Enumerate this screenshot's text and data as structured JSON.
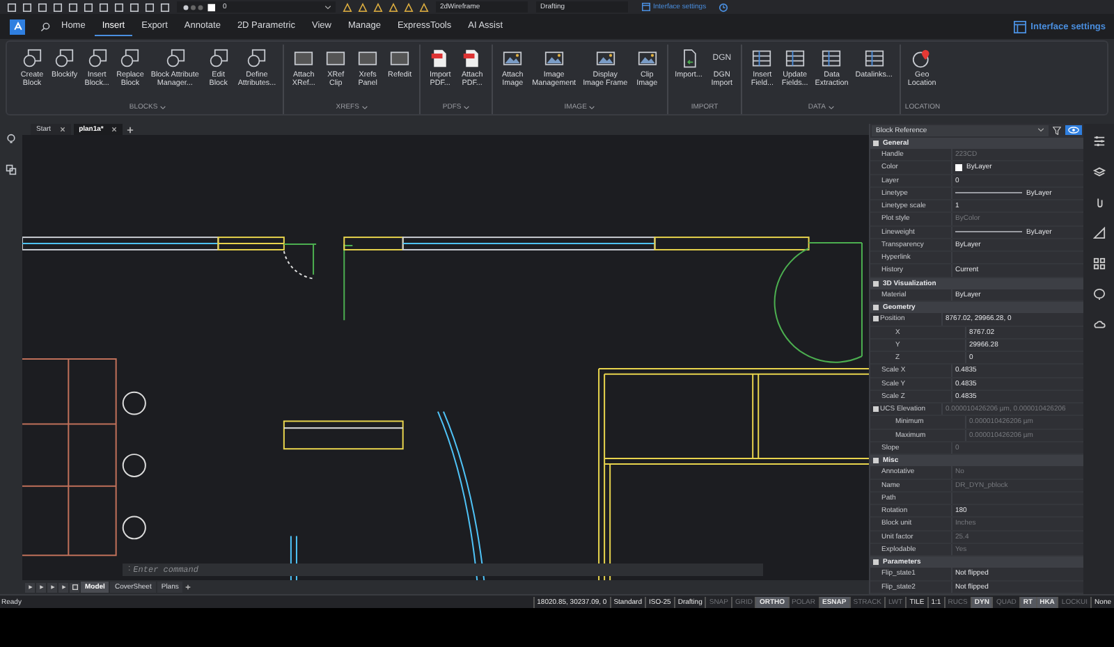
{
  "top_bar": {
    "layer_value": "0",
    "visual_style": "2dWireframe",
    "workspace": "Drafting",
    "settings_link": "Interface settings"
  },
  "ribbon_tabs": [
    {
      "label": "Home",
      "selected": false
    },
    {
      "label": "Insert",
      "selected": true
    },
    {
      "label": "Export",
      "selected": false
    },
    {
      "label": "Annotate",
      "selected": false
    },
    {
      "label": "2D Parametric",
      "selected": false
    },
    {
      "label": "View",
      "selected": false
    },
    {
      "label": "Manage",
      "selected": false
    },
    {
      "label": "ExpressTools",
      "selected": false
    },
    {
      "label": "AI Assist",
      "selected": false
    }
  ],
  "interface_settings": "Interface settings",
  "ribbon_panels": [
    {
      "title": "BLOCKS",
      "kind": "blocks",
      "expandable": true,
      "buttons": [
        {
          "lines": [
            "Create",
            "Block"
          ]
        },
        {
          "lines": [
            "Blockify"
          ]
        },
        {
          "lines": [
            "Insert",
            "Block..."
          ]
        },
        {
          "lines": [
            "Replace",
            "Block"
          ]
        },
        {
          "lines": [
            "Block Attribute",
            "Manager..."
          ]
        },
        {
          "lines": [
            "Edit",
            "Block"
          ]
        },
        {
          "lines": [
            "Define",
            "Attributes..."
          ]
        }
      ]
    },
    {
      "title": "XREFS",
      "kind": "xrefs",
      "expandable": true,
      "buttons": [
        {
          "lines": [
            "Attach",
            "XRef..."
          ]
        },
        {
          "lines": [
            "XRef",
            "Clip"
          ]
        },
        {
          "lines": [
            "Xrefs",
            "Panel"
          ]
        },
        {
          "lines": [
            "Refedit"
          ]
        }
      ]
    },
    {
      "title": "PDFS",
      "kind": "pdfs",
      "expandable": true,
      "buttons": [
        {
          "lines": [
            "Import",
            "PDF..."
          ]
        },
        {
          "lines": [
            "Attach",
            "PDF..."
          ]
        }
      ]
    },
    {
      "title": "IMAGE",
      "kind": "image",
      "expandable": true,
      "buttons": [
        {
          "lines": [
            "Attach",
            "Image"
          ]
        },
        {
          "lines": [
            "Image",
            "Management"
          ]
        },
        {
          "lines": [
            "Display",
            "Image Frame"
          ]
        },
        {
          "lines": [
            "Clip",
            "Image"
          ]
        }
      ]
    },
    {
      "title": "IMPORT",
      "kind": "import",
      "expandable": false,
      "buttons": [
        {
          "lines": [
            "Import..."
          ]
        },
        {
          "lines": [
            "DGN",
            "Import"
          ],
          "icon_text": "DGN"
        }
      ]
    },
    {
      "title": "DATA",
      "kind": "data",
      "expandable": true,
      "buttons": [
        {
          "lines": [
            "Insert",
            "Field..."
          ]
        },
        {
          "lines": [
            "Update",
            "Fields..."
          ]
        },
        {
          "lines": [
            "Data",
            "Extraction"
          ]
        },
        {
          "lines": [
            "Datalinks..."
          ]
        }
      ]
    },
    {
      "title": "LOCATION",
      "kind": "location",
      "expandable": false,
      "buttons": [
        {
          "lines": [
            "Geo",
            "Location"
          ]
        }
      ]
    }
  ],
  "document_tabs": [
    {
      "label": "Start",
      "selected": false
    },
    {
      "label": "plan1a*",
      "selected": true
    }
  ],
  "command_line": {
    "prompt": ":",
    "placeholder": "Enter command"
  },
  "layout_tabs": [
    {
      "label": "Model",
      "selected": true
    },
    {
      "label": "CoverSheet",
      "selected": false
    },
    {
      "label": "Plans",
      "selected": false
    }
  ],
  "properties": {
    "object_type": "Block Reference",
    "rows": [
      {
        "kind": "section",
        "label": "General"
      },
      {
        "kind": "text",
        "label": "Handle",
        "value": "223CD",
        "dimmed": true
      },
      {
        "kind": "color",
        "label": "Color",
        "value": "ByLayer",
        "dimmed": false
      },
      {
        "kind": "text",
        "label": "Layer",
        "value": "0",
        "dimmed": false
      },
      {
        "kind": "line",
        "label": "Linetype",
        "value": "ByLayer",
        "dimmed": false
      },
      {
        "kind": "text",
        "label": "Linetype scale",
        "value": "1",
        "dimmed": false
      },
      {
        "kind": "text",
        "label": "Plot style",
        "value": "ByColor",
        "dimmed": true
      },
      {
        "kind": "line",
        "label": "Lineweight",
        "value": "ByLayer",
        "dimmed": false
      },
      {
        "kind": "text",
        "label": "Transparency",
        "value": "ByLayer",
        "dimmed": false
      },
      {
        "kind": "text",
        "label": "Hyperlink",
        "value": ""
      },
      {
        "kind": "text",
        "label": "History",
        "value": "Current",
        "dimmed": false
      },
      {
        "kind": "section",
        "label": "3D Visualization"
      },
      {
        "kind": "text",
        "label": "Material",
        "value": "ByLayer",
        "dimmed": false
      },
      {
        "kind": "section",
        "label": "Geometry"
      },
      {
        "kind": "text",
        "label": "Position",
        "value": "8767.02, 29966.28, 0",
        "dimmed": false,
        "children": [
          {
            "kind": "text",
            "label": "X",
            "value": "8767.02",
            "dimmed": false
          },
          {
            "kind": "text",
            "label": "Y",
            "value": "29966.28",
            "dimmed": false
          },
          {
            "kind": "text",
            "label": "Z",
            "value": "0",
            "dimmed": false
          }
        ]
      },
      {
        "kind": "text",
        "label": "Scale X",
        "value": "0.4835",
        "dimmed": false
      },
      {
        "kind": "text",
        "label": "Scale Y",
        "value": "0.4835",
        "dimmed": false
      },
      {
        "kind": "text",
        "label": "Scale Z",
        "value": "0.4835",
        "dimmed": false
      },
      {
        "kind": "text",
        "label": "UCS Elevation",
        "value": "0.000010426206 µm, 0.000010426206",
        "dimmed": true,
        "children": [
          {
            "kind": "text",
            "label": "Minimum",
            "value": "0.000010426206 µm",
            "dimmed": true
          },
          {
            "kind": "text",
            "label": "Maximum",
            "value": "0.000010426206 µm",
            "dimmed": true
          }
        ]
      },
      {
        "kind": "text",
        "label": "Slope",
        "value": "0",
        "dimmed": true
      },
      {
        "kind": "section",
        "label": "Misc"
      },
      {
        "kind": "text",
        "label": "Annotative",
        "value": "No",
        "dimmed": true
      },
      {
        "kind": "text",
        "label": "Name",
        "value": "DR_DYN_pblock",
        "dimmed": true
      },
      {
        "kind": "text",
        "label": "Path",
        "value": ""
      },
      {
        "kind": "text",
        "label": "Rotation",
        "value": "180",
        "dimmed": false
      },
      {
        "kind": "text",
        "label": "Block unit",
        "value": "Inches",
        "dimmed": true
      },
      {
        "kind": "text",
        "label": "Unit factor",
        "value": "25.4",
        "dimmed": true
      },
      {
        "kind": "text",
        "label": "Explodable",
        "value": "Yes",
        "dimmed": true
      },
      {
        "kind": "section",
        "label": "Parameters"
      },
      {
        "kind": "text",
        "label": "Flip_state1",
        "value": "Not flipped",
        "dimmed": false
      },
      {
        "kind": "text",
        "label": "Flip_state2",
        "value": "Not flipped",
        "dimmed": false
      }
    ]
  },
  "status_bar": {
    "message": "Ready",
    "items": [
      {
        "label": "18020.85, 30237.09, 0",
        "on": false,
        "disabled": false
      },
      {
        "label": "Standard",
        "on": false,
        "disabled": false
      },
      {
        "label": "ISO-25",
        "on": false,
        "disabled": false
      },
      {
        "label": "Drafting",
        "on": false,
        "disabled": false
      },
      {
        "label": "SNAP",
        "on": false,
        "disabled": true
      },
      {
        "label": "GRID",
        "on": false,
        "disabled": true
      },
      {
        "label": "ORTHO",
        "on": true,
        "disabled": false
      },
      {
        "label": "POLAR",
        "on": false,
        "disabled": true
      },
      {
        "label": "ESNAP",
        "on": true,
        "disabled": false
      },
      {
        "label": "STRACK",
        "on": false,
        "disabled": true
      },
      {
        "label": "LWT",
        "on": false,
        "disabled": true
      },
      {
        "label": "TILE",
        "on": false,
        "disabled": false
      },
      {
        "label": "1:1",
        "on": false,
        "disabled": false
      },
      {
        "label": "RUCS",
        "on": false,
        "disabled": true
      },
      {
        "label": "DYN",
        "on": true,
        "disabled": false
      },
      {
        "label": "QUAD",
        "on": false,
        "disabled": true
      },
      {
        "label": "RT",
        "on": true,
        "disabled": false
      },
      {
        "label": "HKA",
        "on": true,
        "disabled": false
      },
      {
        "label": "LOCKUI",
        "on": false,
        "disabled": true
      },
      {
        "label": "None",
        "on": false,
        "disabled": false
      }
    ]
  }
}
